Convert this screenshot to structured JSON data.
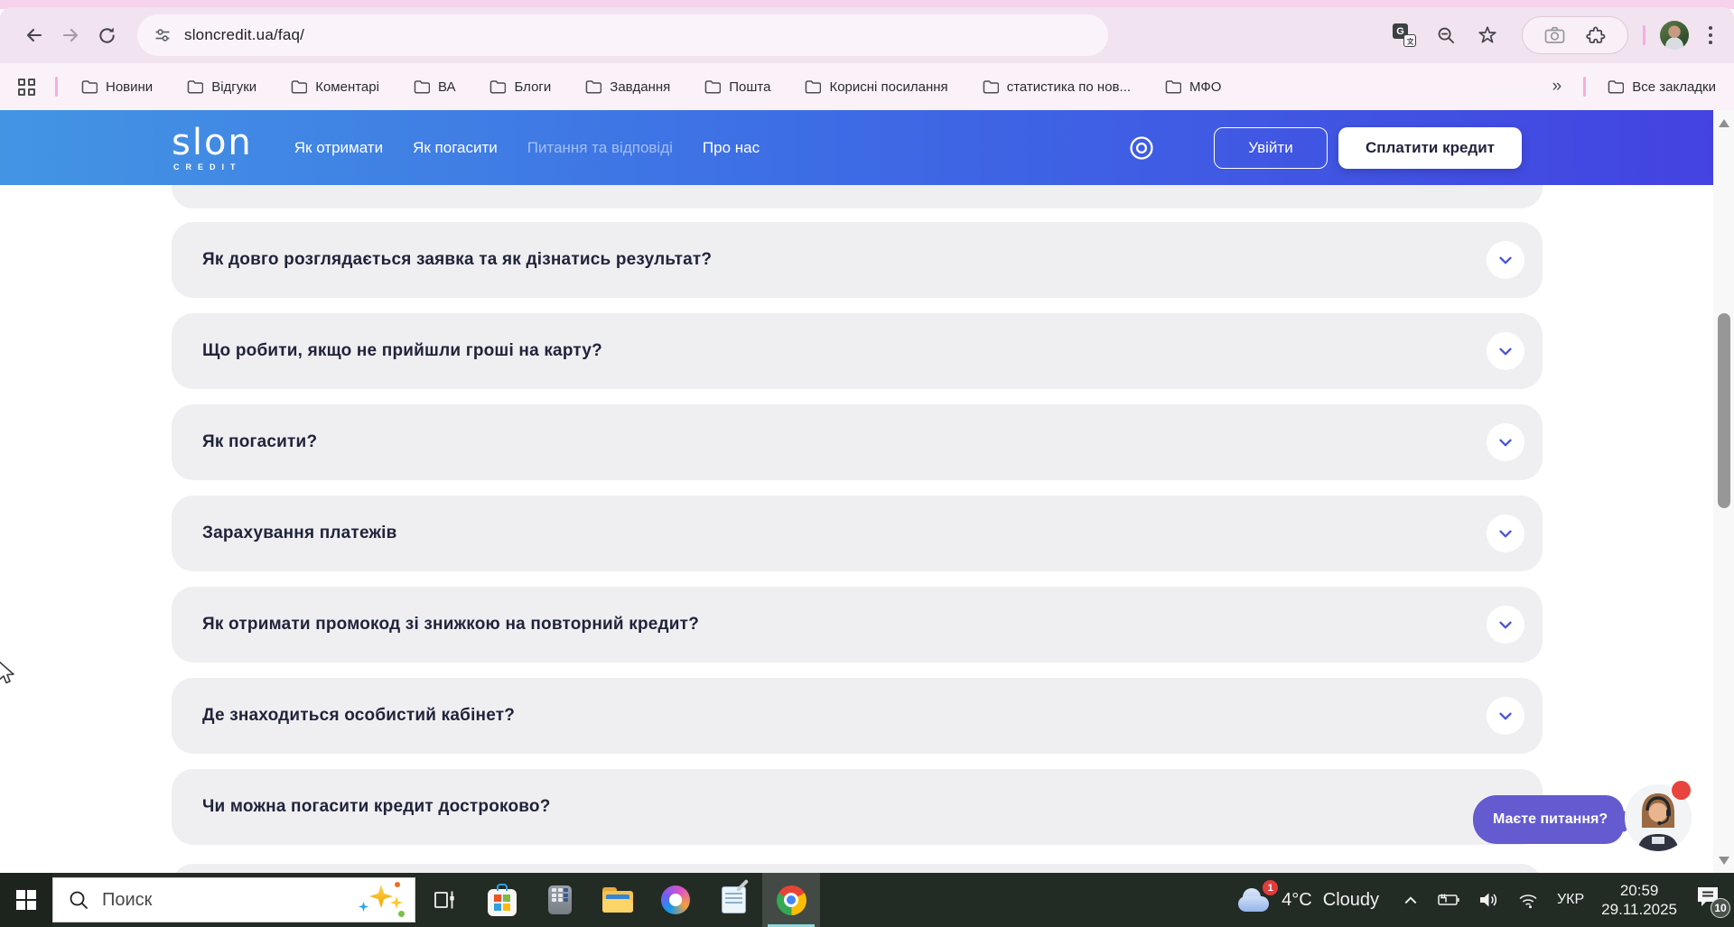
{
  "browser": {
    "url": "sloncredit.ua/faq/",
    "bookmarks": [
      "Новини",
      "Відгуки",
      "Коментарі",
      "ВА",
      "Блоги",
      "Завдання",
      "Пошта",
      "Корисні посилання",
      "статистика по нов...",
      "МФО"
    ],
    "overflow_chevron": "»",
    "all_bookmarks": "Все закладки"
  },
  "header": {
    "logo": "slon",
    "logo_sub": "CREDIT",
    "nav": [
      {
        "label": "Як отримати"
      },
      {
        "label": "Як погасити"
      },
      {
        "label": "Питання та відповіді"
      },
      {
        "label": "Про нас"
      }
    ],
    "login": "Увійти",
    "pay": "Сплатити кредит"
  },
  "faq": {
    "items": [
      "Як довго розглядається заявка та як дізнатись результат?",
      "Що робити, якщо не прийшли гроші на карту?",
      "Як погасити?",
      "Зарахування платежів",
      "Як отримати промокод зі знижкою на повторний кредит?",
      "Де знаходиться особистий кабінет?",
      "Чи можна погасити кредит достроково?"
    ]
  },
  "chat": {
    "bubble": "Маєте питання?"
  },
  "taskbar": {
    "search": "Поиск",
    "weather_badge": "1",
    "temperature": "4°C",
    "condition": "Cloudy",
    "language": "УКР",
    "time": "20:59",
    "date": "29.11.2025",
    "notifications": "10"
  },
  "colors": {
    "header_gradient_start": "#4395e4",
    "header_gradient_end": "#4343e1",
    "card_bg": "#efeff2",
    "chevron_blue": "#4b55d6",
    "chat_bubble": "#655bd0",
    "taskbar_bg": "#232b25"
  }
}
